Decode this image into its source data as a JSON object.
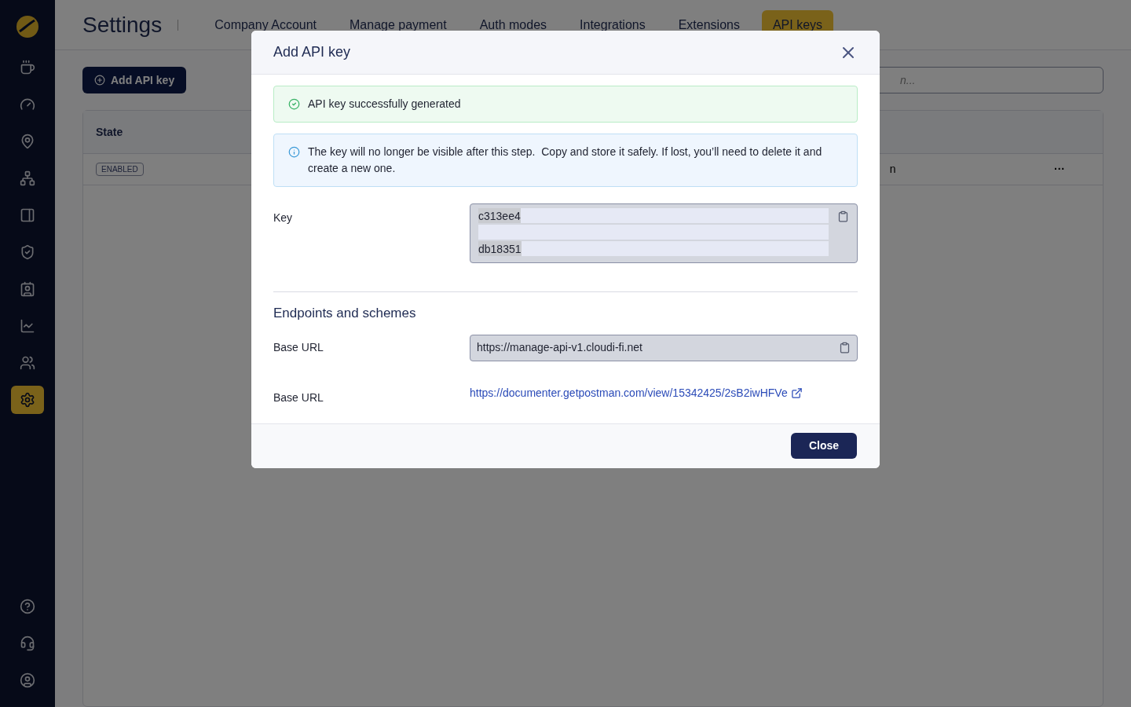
{
  "sidebar": {
    "items": [
      {
        "selected": false
      },
      {
        "selected": false
      },
      {
        "selected": false
      },
      {
        "selected": false
      },
      {
        "selected": false
      },
      {
        "selected": false
      },
      {
        "selected": false
      },
      {
        "selected": false
      },
      {
        "selected": false
      },
      {
        "selected": true
      }
    ]
  },
  "header": {
    "title": "Settings",
    "tabs": [
      {
        "label": "Company Account",
        "selected": false
      },
      {
        "label": "Manage payment",
        "selected": false
      },
      {
        "label": "Auth modes",
        "selected": false
      },
      {
        "label": "Integrations",
        "selected": false
      },
      {
        "label": "Extensions",
        "selected": false
      },
      {
        "label": "API keys",
        "selected": true
      }
    ]
  },
  "toolbar": {
    "add_button": "Add API key",
    "search": {
      "placeholder": "n..."
    }
  },
  "table": {
    "columns": [
      "State"
    ],
    "rows": [
      {
        "state": "ENABLED",
        "cell_2": "n",
        "menu": "···"
      }
    ]
  },
  "dialog": {
    "title": "Add API key",
    "success": "API key successfully generated",
    "info": "The key will no longer be visible after this step.  Copy and store it safely. If lost, you’ll need to delete it and create a new one.",
    "key": {
      "label": "Key",
      "first_line": "c313ee4",
      "last_line": "db18351"
    },
    "section_title": "Endpoints and schemes",
    "base_url": {
      "label": "Base URL",
      "value": "https://manage-api-v1.cloudi-fi.net"
    },
    "docs": {
      "label": "Base URL",
      "link": "https://documenter.getpostman.com/view/15342425/2sB2iwHFVe"
    },
    "close_button": "Close"
  }
}
